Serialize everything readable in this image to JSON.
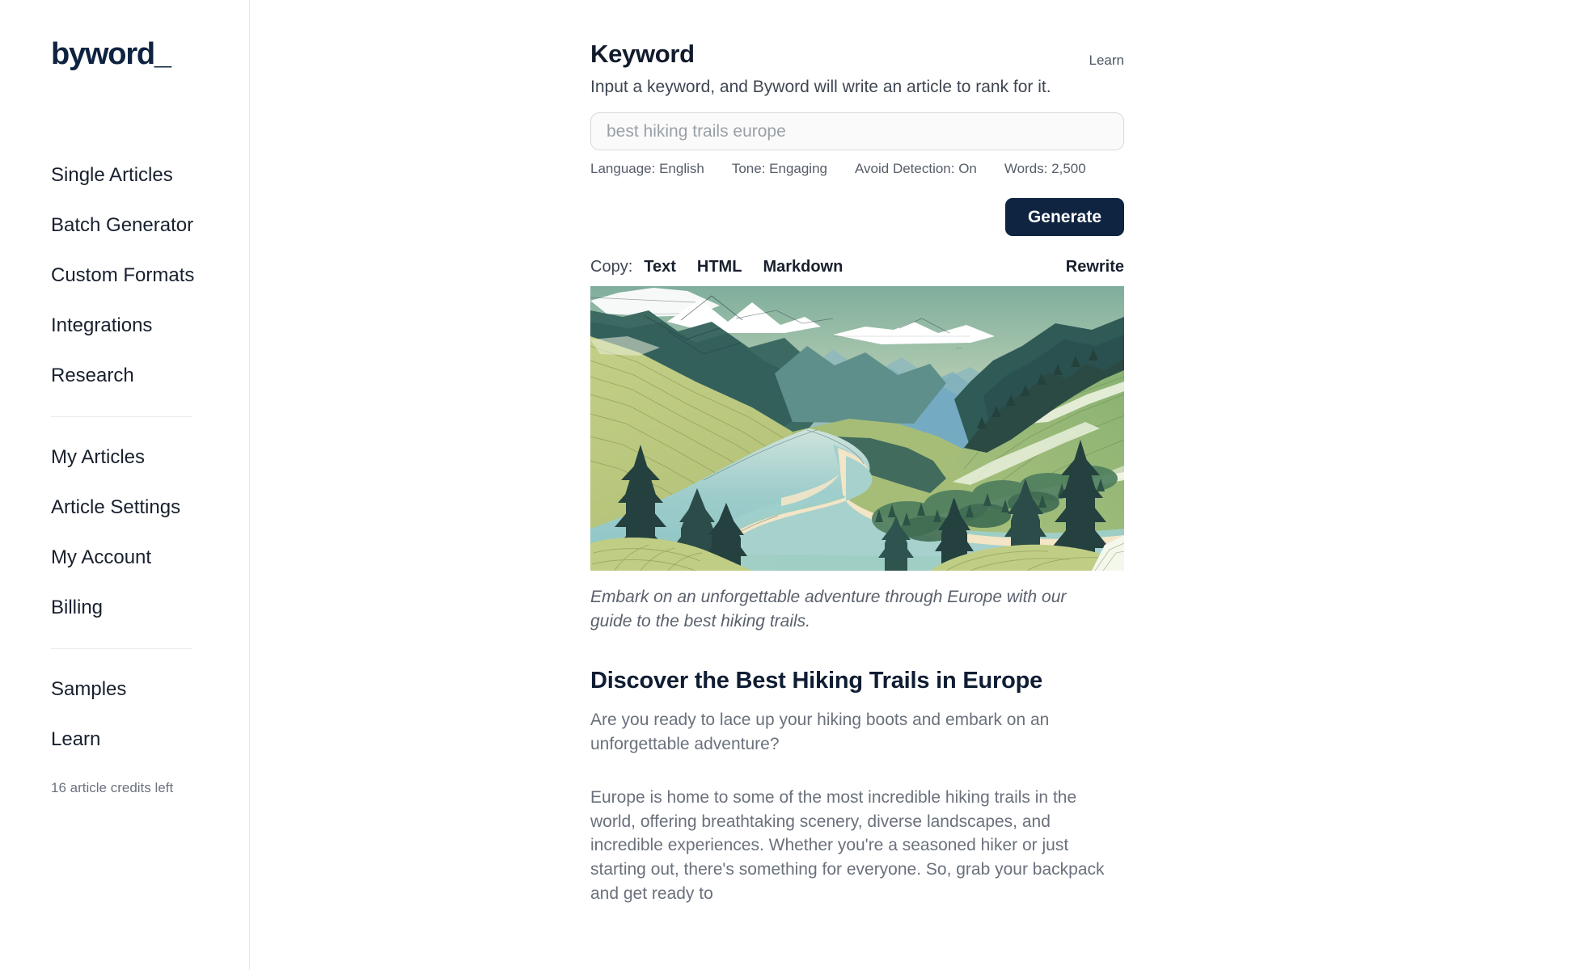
{
  "brand": {
    "logo": "byword_"
  },
  "sidebar": {
    "group1": [
      {
        "label": "Single Articles"
      },
      {
        "label": "Batch Generator"
      },
      {
        "label": "Custom Formats"
      },
      {
        "label": "Integrations"
      },
      {
        "label": "Research"
      }
    ],
    "group2": [
      {
        "label": "My Articles"
      },
      {
        "label": "Article Settings"
      },
      {
        "label": "My Account"
      },
      {
        "label": "Billing"
      }
    ],
    "group3": [
      {
        "label": "Samples"
      },
      {
        "label": "Learn"
      }
    ],
    "credits": "16 article credits left"
  },
  "header": {
    "title": "Keyword",
    "learn_label": "Learn",
    "subtitle": "Input a keyword, and Byword will write an article to rank for it."
  },
  "keyword_input": {
    "value": "",
    "placeholder": "best hiking trails europe"
  },
  "settings": [
    {
      "label": "Language: English"
    },
    {
      "label": "Tone: Engaging"
    },
    {
      "label": "Avoid Detection: On"
    },
    {
      "label": "Words: 2,500"
    }
  ],
  "actions": {
    "generate_label": "Generate"
  },
  "copy_bar": {
    "label": "Copy:",
    "options": [
      {
        "label": "Text"
      },
      {
        "label": "HTML"
      },
      {
        "label": "Markdown"
      }
    ],
    "rewrite_label": "Rewrite"
  },
  "article": {
    "hero_alt": "mountain-valley-illustration",
    "caption": "Embark on an unforgettable adventure through Europe with our guide to the best hiking trails.",
    "heading": "Discover the Best Hiking Trails in Europe",
    "paragraph_1": "Are you ready to lace up your hiking boots and embark on an unforgettable adventure?",
    "paragraph_2": "Europe is home to some of the most incredible hiking trails in the world, offering breathtaking scenery, diverse landscapes, and incredible experiences. Whether you're a seasoned hiker or just starting out, there's something for everyone. So, grab your backpack and get ready to"
  },
  "colors": {
    "brand_navy": "#0f2440",
    "text_primary": "#18202e",
    "text_muted": "#6a717c",
    "border": "#e8e9eb",
    "input_bg": "#fafafa"
  }
}
